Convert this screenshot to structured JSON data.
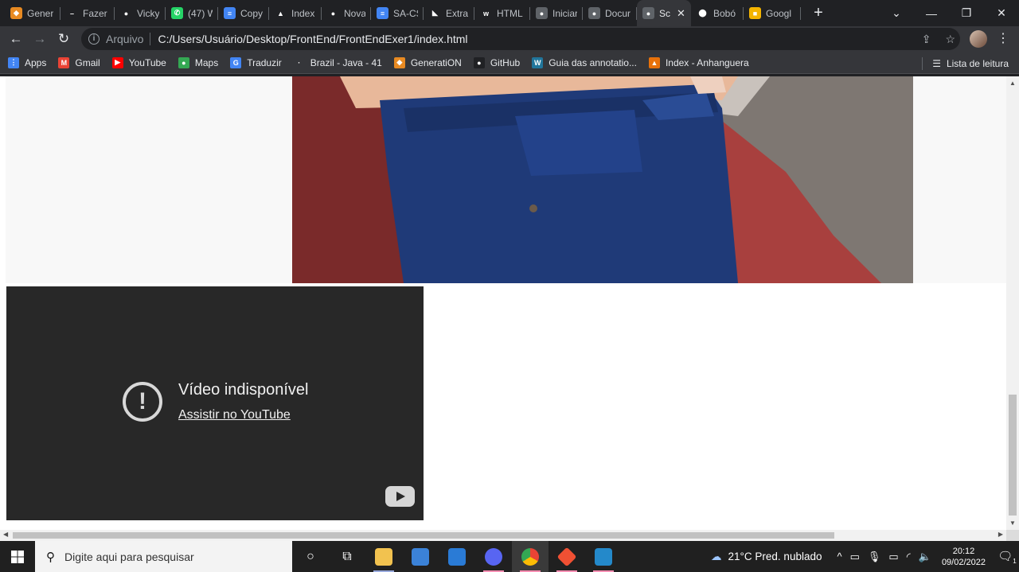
{
  "browser": {
    "tabs": [
      {
        "title": "Gener",
        "icon_color": "#e88a22",
        "icon_glyph": "◆"
      },
      {
        "title": "Fazer",
        "icon_color": "#202124",
        "icon_glyph": "–"
      },
      {
        "title": "Vicky",
        "icon_color": "#202124",
        "icon_glyph": "●"
      },
      {
        "title": "(47) W",
        "icon_color": "#25d366",
        "icon_glyph": "✆"
      },
      {
        "title": "Copy",
        "icon_color": "#4285f4",
        "icon_glyph": "≡"
      },
      {
        "title": "Index",
        "icon_color": "#202124",
        "icon_glyph": "▲"
      },
      {
        "title": "Nova",
        "icon_color": "#202124",
        "icon_glyph": "●"
      },
      {
        "title": "SA-CS",
        "icon_color": "#4285f4",
        "icon_glyph": "≡"
      },
      {
        "title": "Extra",
        "icon_color": "#202124",
        "icon_glyph": "◣"
      },
      {
        "title": "HTML",
        "icon_color": "#202124",
        "icon_glyph": "w"
      },
      {
        "title": "Iniciar",
        "icon_color": "#5f6368",
        "icon_glyph": "●"
      },
      {
        "title": "Docur",
        "icon_color": "#5f6368",
        "icon_glyph": "●"
      },
      {
        "title": "Sc",
        "icon_color": "#5f6368",
        "icon_glyph": "●",
        "active": true
      },
      {
        "title": "Bobó",
        "icon_color": "#202124",
        "icon_glyph": "⬤"
      },
      {
        "title": "Googl",
        "icon_color": "#f4b400",
        "icon_glyph": "■"
      }
    ],
    "new_tab_label": "+",
    "omnibox": {
      "scheme": "Arquivo",
      "url": "C:/Users/Usuário/Desktop/FrontEnd/FrontEndExer1/index.html"
    },
    "bookmarks": [
      {
        "label": "Apps",
        "icon_color": "#4285f4",
        "icon_glyph": "⋮"
      },
      {
        "label": "Gmail",
        "icon_color": "#ea4335",
        "icon_glyph": "M"
      },
      {
        "label": "YouTube",
        "icon_color": "#ff0000",
        "icon_glyph": "▶"
      },
      {
        "label": "Maps",
        "icon_color": "#34a853",
        "icon_glyph": "●"
      },
      {
        "label": "Traduzir",
        "icon_color": "#4285f4",
        "icon_glyph": "G"
      },
      {
        "label": "Brazil - Java - 41",
        "icon_color": "#35363a",
        "icon_glyph": "·"
      },
      {
        "label": "GeneratiON",
        "icon_color": "#e88a22",
        "icon_glyph": "◆"
      },
      {
        "label": "GitHub",
        "icon_color": "#202124",
        "icon_glyph": "●"
      },
      {
        "label": "Guia das annotatio...",
        "icon_color": "#21759b",
        "icon_glyph": "W"
      },
      {
        "label": "Index - Anhanguera",
        "icon_color": "#e8710a",
        "icon_glyph": "▲"
      }
    ],
    "reading_list_label": "Lista de leitura"
  },
  "page": {
    "video": {
      "title": "Vídeo indisponível",
      "link_text": "Assistir no YouTube"
    }
  },
  "taskbar": {
    "search_placeholder": "Digite aqui para pesquisar",
    "weather": "21°C  Pred. nublado",
    "time": "20:12",
    "date": "09/02/2022",
    "notification_count": "1"
  }
}
